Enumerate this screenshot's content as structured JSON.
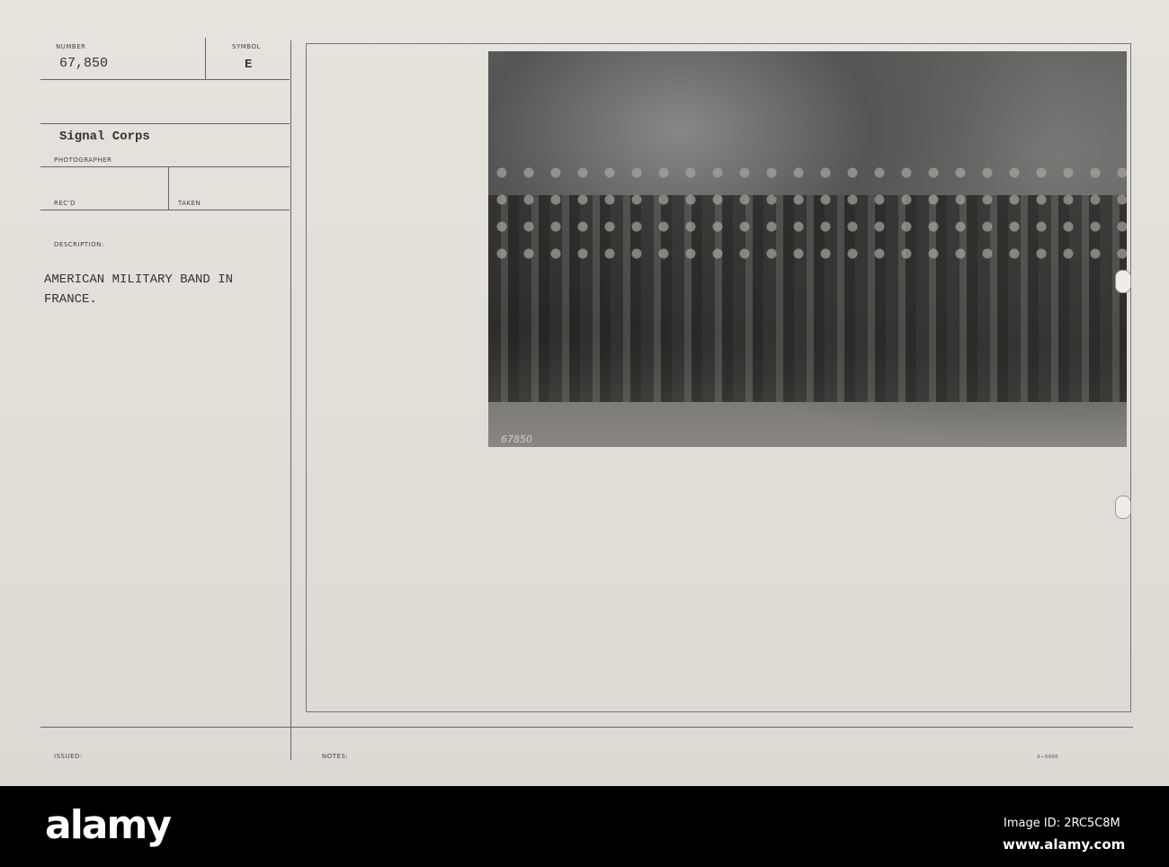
{
  "card": {
    "number_label": "NUMBER",
    "number": "67,850",
    "symbol_label": "SYMBOL",
    "symbol": "E",
    "photographer": "Signal Corps",
    "photographer_label": "PHOTOGRAPHER",
    "recd_label": "REC'D",
    "taken_label": "TAKEN",
    "description_label": "DESCRIPTION:",
    "description_line1": "AMERICAN MILITARY BAND IN",
    "description_line2": "FRANCE.",
    "issued_label": "ISSUED:",
    "notes_label": "NOTES:",
    "form_code": "3—5000",
    "photo_number": "67850"
  },
  "footer": {
    "logo": "alamy",
    "image_id": "Image ID: 2RC5C8M",
    "url": "www.alamy.com"
  }
}
